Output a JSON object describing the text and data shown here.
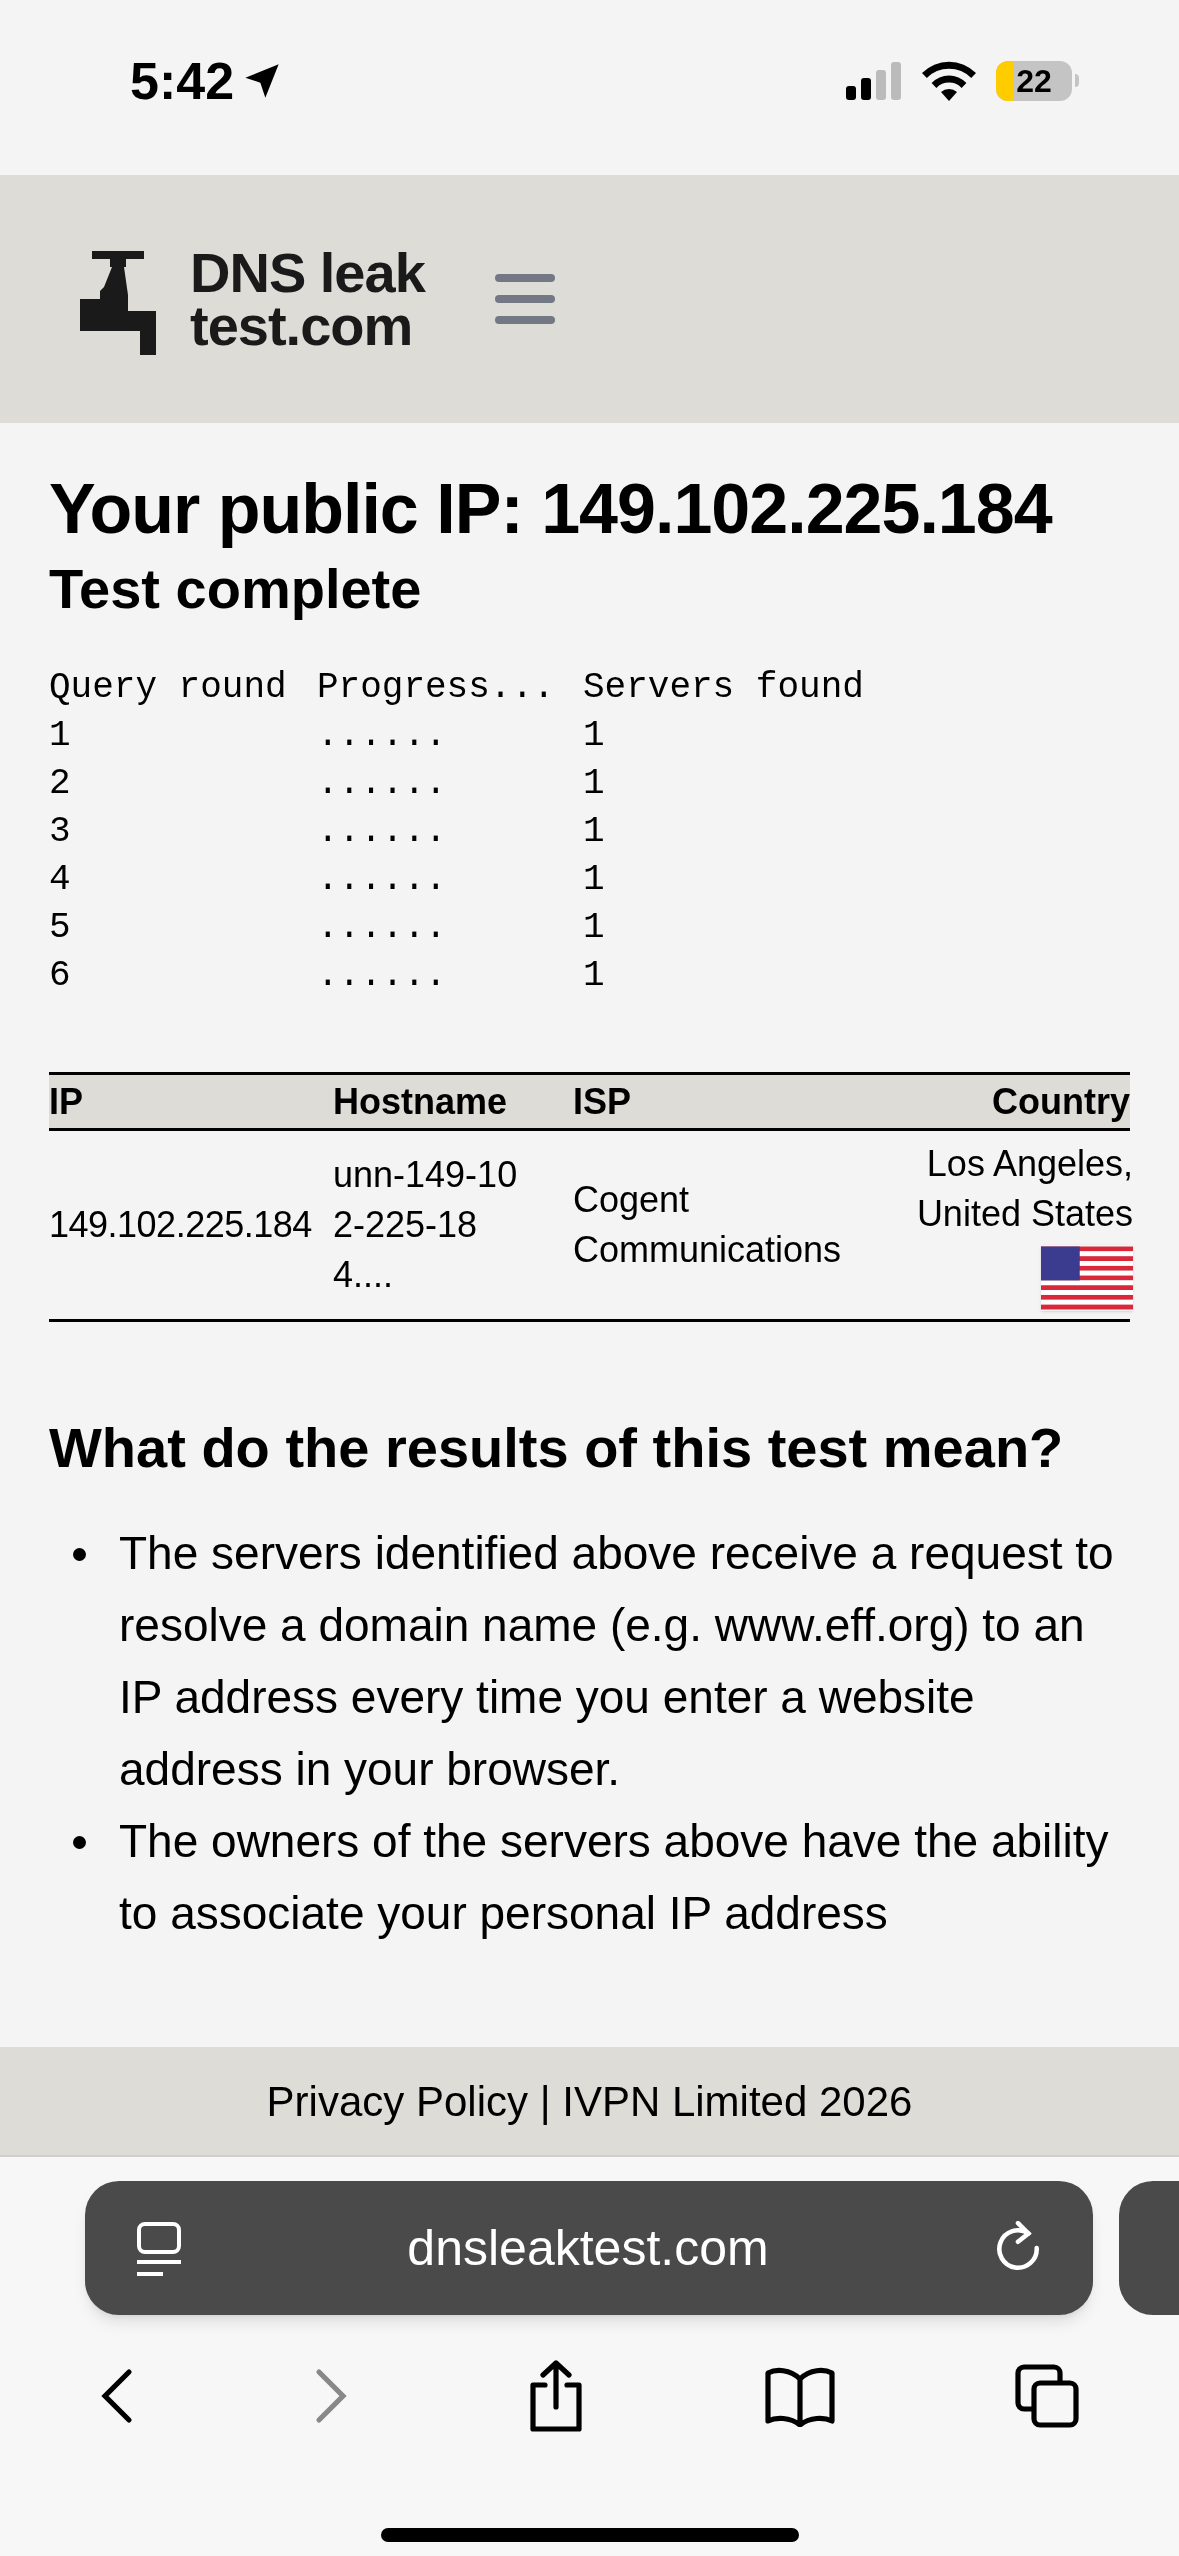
{
  "status_bar": {
    "time": "5:42",
    "battery": "22"
  },
  "header": {
    "logo_line_1": "DNS leak",
    "logo_line_2": "test.com"
  },
  "title": "Your public IP: 149.102.225.184",
  "subtitle": "Test complete",
  "query_table": {
    "columns": [
      "Query round",
      "Progress...",
      "Servers found"
    ],
    "rows": [
      [
        "1",
        "......",
        "1"
      ],
      [
        "2",
        "......",
        "1"
      ],
      [
        "3",
        "......",
        "1"
      ],
      [
        "4",
        "......",
        "1"
      ],
      [
        "5",
        "......",
        "1"
      ],
      [
        "6",
        "......",
        "1"
      ]
    ]
  },
  "results_table": {
    "columns": [
      "IP",
      "Hostname",
      "ISP",
      "Country"
    ],
    "rows": [
      {
        "ip": "149.102.225.184",
        "hostname": "unn-149-102-225-184....",
        "isp": "Cogent Communications",
        "country": "Los Angeles, United States"
      }
    ]
  },
  "explanation": {
    "heading": "What do the results of this test mean?",
    "bullets": [
      "The servers identified above receive a request to resolve a domain name (e.g. www.eff.org) to an IP address every time you enter a website address in your browser.",
      "The owners of the servers above have the ability to associate your personal IP address"
    ]
  },
  "footer": "Privacy Policy | IVPN Limited 2026",
  "browser": {
    "url": "dnsleaktest.com"
  }
}
